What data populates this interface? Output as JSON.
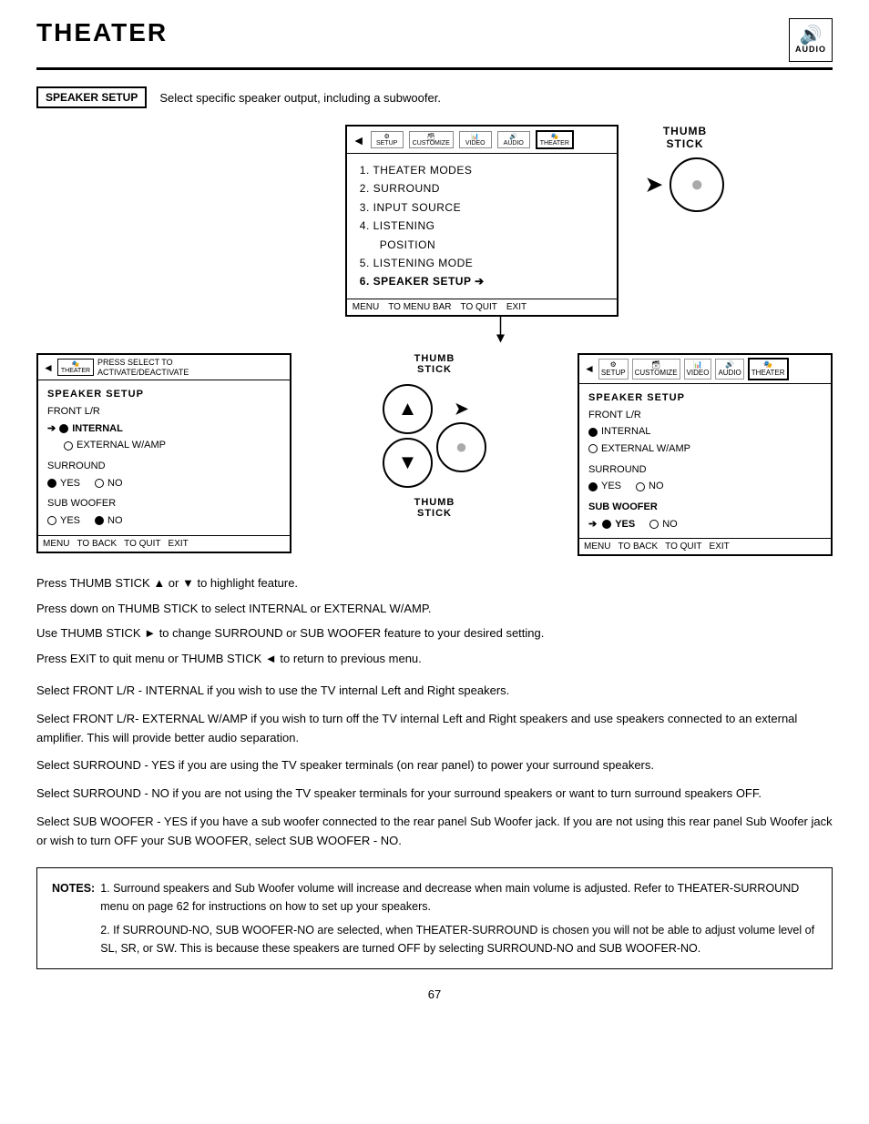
{
  "page": {
    "title": "THEATER",
    "page_number": "67"
  },
  "audio_icon": {
    "symbol": "🔊",
    "label": "AUDIO"
  },
  "speaker_setup": {
    "label": "SPEAKER SETUP",
    "description": "Select specific speaker output, including a subwoofer."
  },
  "top_screen": {
    "toolbar": {
      "arrow": "◄",
      "icons": [
        "SETUP",
        "CUSTOMIZE",
        "VIDEO",
        "AUDIO",
        "THEATER"
      ]
    },
    "menu_items": [
      "1. THEATER MODES",
      "2. SURROUND",
      "3. INPUT SOURCE",
      "4. LISTENING",
      "   POSITION",
      "5. LISTENING MODE",
      "6. SPEAKER SETUP ➔"
    ],
    "footer": [
      "MENU",
      "TO MENU BAR",
      "TO QUIT",
      "EXIT"
    ]
  },
  "thumb_stick_label": "THUMB\nSTICK",
  "bottom_left_screen": {
    "toolbar_text": "PRESS SELECT TO\nACTIVATE/DEACTIVATE",
    "content": {
      "title": "SPEAKER SETUP",
      "front_lr_label": "FRONT L/R",
      "options_front": [
        {
          "selected": true,
          "arrow": true,
          "label": "⊙ INTERNAL",
          "bold": true
        },
        {
          "selected": false,
          "arrow": false,
          "label": "○ EXTERNAL W/AMP"
        }
      ],
      "surround_label": "SURROUND",
      "options_surround": [
        {
          "radio": "filled",
          "label": "YES"
        },
        {
          "radio": "empty",
          "label": "NO"
        }
      ],
      "subwoofer_label": "SUB WOOFER",
      "options_subwoofer": [
        {
          "radio": "empty",
          "label": "YES"
        },
        {
          "radio": "filled",
          "label": "NO"
        }
      ]
    },
    "footer": [
      "MENU",
      "TO BACK",
      "TO QUIT",
      "EXIT"
    ]
  },
  "bottom_right_screen": {
    "toolbar": {
      "arrow": "◄",
      "icons": [
        "SETUP",
        "CUSTOMIZE",
        "VIDEO",
        "AUDIO",
        "THEATER"
      ]
    },
    "content": {
      "title": "SPEAKER SETUP",
      "front_lr_label": "FRONT L/R",
      "options_front": [
        {
          "radio": "filled",
          "label": "INTERNAL"
        },
        {
          "radio": "empty",
          "label": "EXTERNAL W/AMP"
        }
      ],
      "surround_label": "SURROUND",
      "options_surround": [
        {
          "radio": "filled",
          "label": "YES"
        },
        {
          "radio": "empty",
          "label": "NO"
        }
      ],
      "subwoofer_label": "SUB WOOFER",
      "subwoofer_bold": true,
      "options_subwoofer": [
        {
          "radio": "filled",
          "label": "YES",
          "arrow": true
        },
        {
          "radio": "empty",
          "label": "NO"
        }
      ]
    },
    "footer": [
      "MENU",
      "TO BACK",
      "TO QUIT",
      "EXIT"
    ]
  },
  "instructions": [
    "Press THUMB STICK ▲ or ▼ to highlight feature.",
    "Press down on THUMB STICK to select INTERNAL or EXTERNAL W/AMP.",
    "Use THUMB STICK ► to change SURROUND or SUB WOOFER feature to your desired setting.",
    "Press EXIT to quit menu or THUMB STICK ◄ to return to previous menu."
  ],
  "paragraphs": [
    "Select FRONT L/R - INTERNAL if you wish to use the TV internal Left and Right speakers.",
    "Select FRONT L/R- EXTERNAL W/AMP if you wish to turn off the TV internal Left and Right speakers and use speakers connected to an external amplifier.  This will provide better audio separation.",
    "Select SURROUND - YES if you are using the TV speaker terminals (on rear panel) to power your surround speakers.",
    "Select SURROUND - NO if you are not using the TV speaker terminals for your surround speakers or want to turn surround speakers OFF.",
    "Select SUB WOOFER - YES if you have a sub woofer connected to the rear panel Sub Woofer jack.  If you are not using this rear panel Sub Woofer jack or wish to turn OFF your SUB WOOFER, select SUB WOOFER - NO."
  ],
  "notes": {
    "label": "NOTES:",
    "items": [
      "1.  Surround speakers and Sub Woofer volume will increase and decrease when main volume is adjusted.   Refer to THEATER-SURROUND menu on page 62 for instructions on how to set up your speakers.",
      "2.  If SURROUND-NO, SUB WOOFER-NO are selected, when THEATER-SURROUND is chosen you will not be able to adjust volume level of SL, SR, or SW.  This is because these speakers are turned OFF by selecting SURROUND-NO and SUB WOOFER-NO."
    ]
  }
}
